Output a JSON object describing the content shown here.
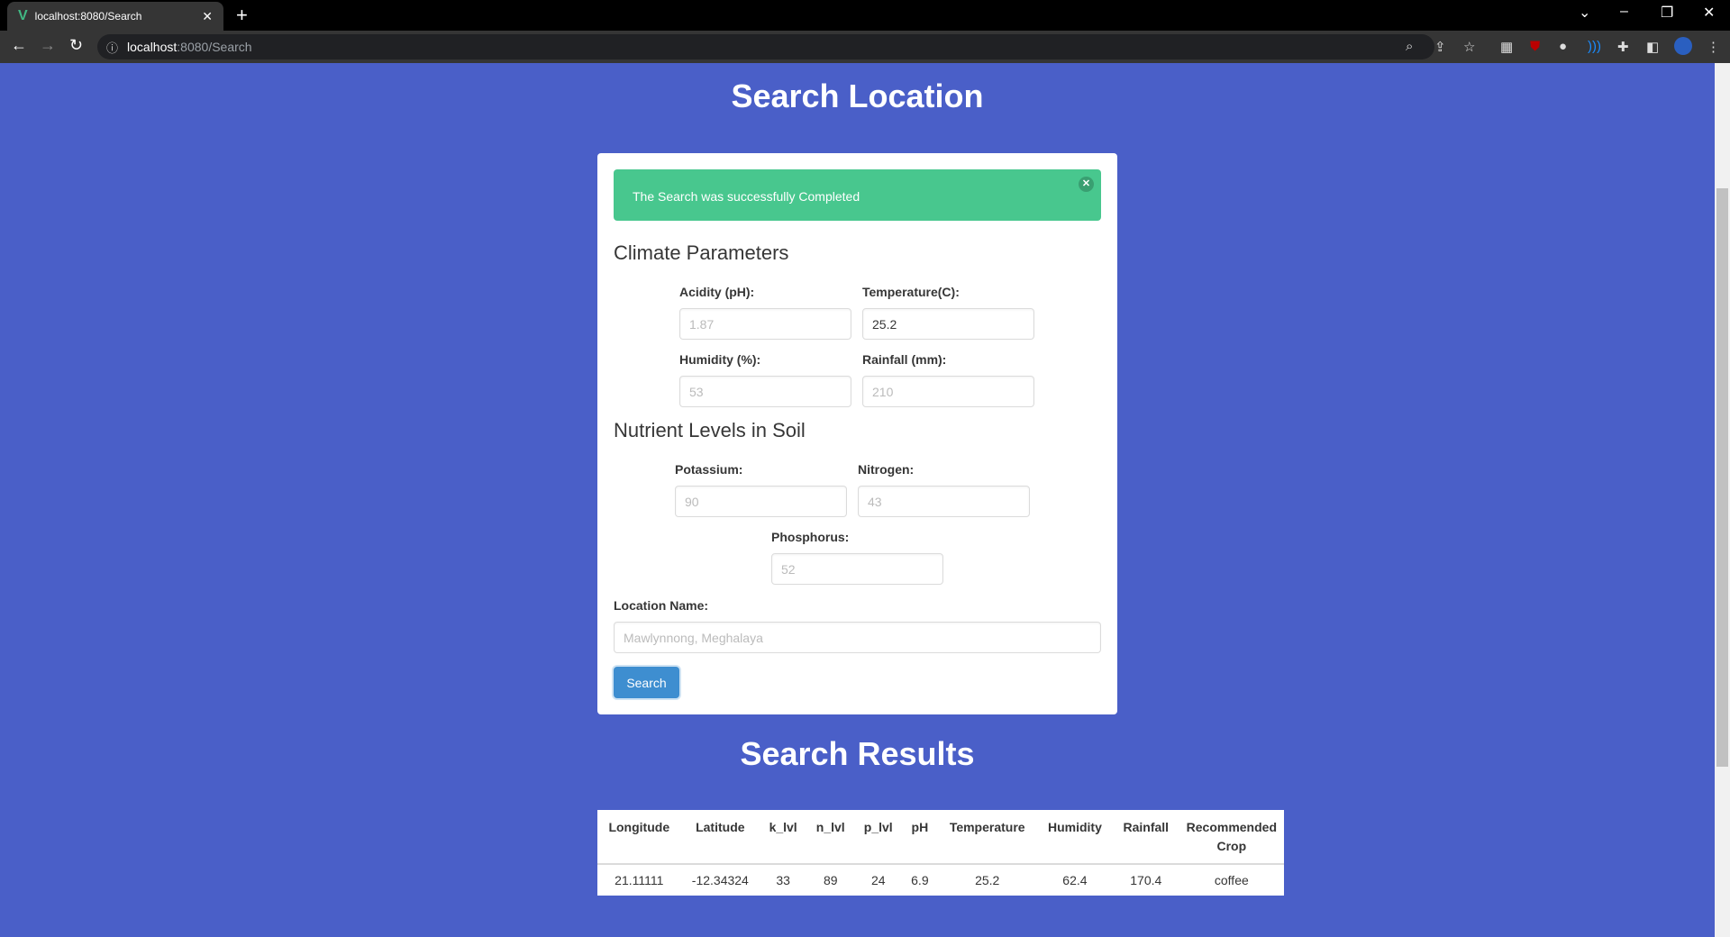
{
  "browser": {
    "tab_title": "localhost:8080/Search",
    "url_host": "localhost",
    "url_rest": ":8080/Search"
  },
  "page": {
    "title": "Search Location",
    "results_title": "Search Results"
  },
  "alert": {
    "message": "The Search was successfully Completed"
  },
  "climate": {
    "heading": "Climate Parameters",
    "acidity": {
      "label": "Acidity (pH):",
      "placeholder": "1.87",
      "value": ""
    },
    "temperature": {
      "label": "Temperature(C):",
      "value": "25.2"
    },
    "humidity": {
      "label": "Humidity (%):",
      "placeholder": "53"
    },
    "rainfall": {
      "label": "Rainfall (mm):",
      "placeholder": "210"
    }
  },
  "nutrients": {
    "heading": "Nutrient Levels in Soil",
    "potassium": {
      "label": "Potassium:",
      "placeholder": "90"
    },
    "nitrogen": {
      "label": "Nitrogen:",
      "placeholder": "43"
    },
    "phosphorus": {
      "label": "Phosphorus:",
      "placeholder": "52"
    }
  },
  "location": {
    "label": "Location Name:",
    "placeholder": "Mawlynnong, Meghalaya"
  },
  "search_button": "Search",
  "table": {
    "headers": [
      "Longitude",
      "Latitude",
      "k_lvl",
      "n_lvl",
      "p_lvl",
      "pH",
      "Temperature",
      "Humidity",
      "Rainfall",
      "Recommended Crop"
    ],
    "rows": [
      [
        "21.11111",
        "-12.34324",
        "33",
        "89",
        "24",
        "6.9",
        "25.2",
        "62.4",
        "170.4",
        "coffee"
      ]
    ]
  }
}
